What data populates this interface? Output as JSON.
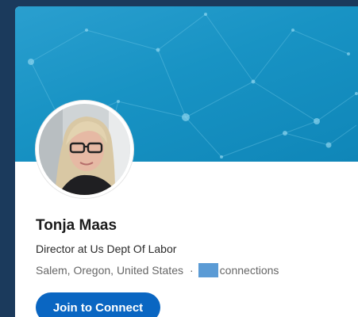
{
  "profile": {
    "name": "Tonja Maas",
    "headline": "Director at Us Dept Of Labor",
    "location": "Salem, Oregon, United States",
    "separator": "·",
    "connections_label": "connections"
  },
  "actions": {
    "join_label": "Join to Connect"
  },
  "colors": {
    "page_background": "#1b3a5c",
    "banner": "#1893c4",
    "join_button": "#0a66c2",
    "redaction": "#5b9bd5"
  }
}
